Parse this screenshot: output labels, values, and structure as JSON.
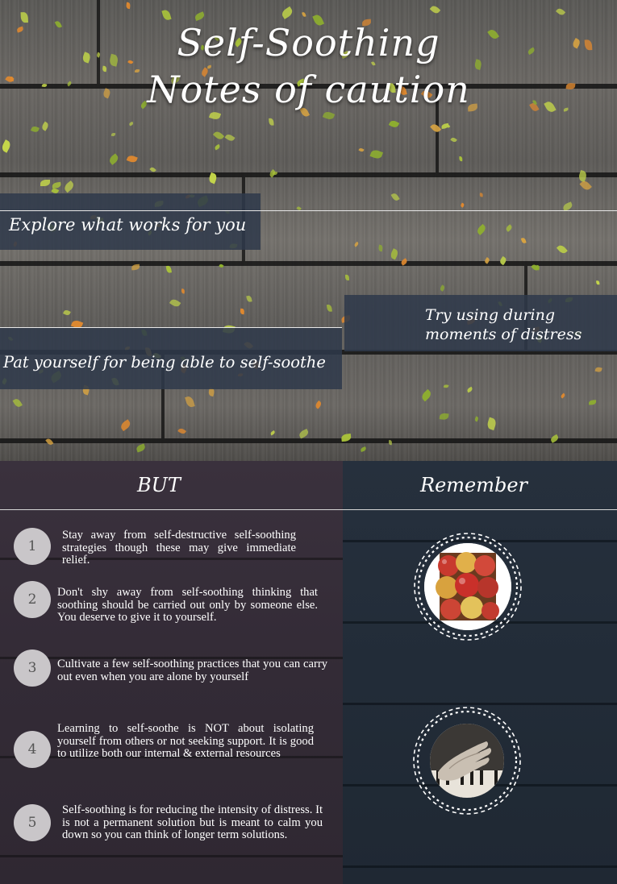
{
  "title": {
    "line1": "Self-Soothing",
    "line2": "Notes of caution"
  },
  "banners": {
    "explore": "Explore what works for you",
    "try_line1": "Try using during",
    "try_line2": "moments of distress",
    "pat": "Pat yourself for being able to self-soothe"
  },
  "columns": {
    "left_heading": "BUT",
    "right_heading": "Remember"
  },
  "notes": [
    {
      "number": "1",
      "text": "Stay away from self-destructive self-soothing strategies though these may give immediate relief."
    },
    {
      "number": "2",
      "text": "Don't shy away from self-soothing thinking that soothing should be carried out only by someone else. You deserve to give it to yourself."
    },
    {
      "number": "3",
      "text": "Cultivate a few self-soothing practices that you can carry out even when you are alone by yourself"
    },
    {
      "number": "4",
      "text": "Learning to self-soothe is NOT about isolating yourself from others or not seeking support. It is good to utilize both our  internal  & external resources"
    },
    {
      "number": "5",
      "text": "Self-soothing is for reducing the intensity of distress. It is not a permanent solution but is meant to calm you down so you can think of longer term solutions."
    }
  ],
  "images": {
    "apples": "apples-photo",
    "hands": "piano-hands-photo"
  },
  "colors": {
    "banner": "#2e394a",
    "left_column": "#352d38",
    "right_column": "#232d39",
    "number_circle": "#c9c6c9"
  }
}
